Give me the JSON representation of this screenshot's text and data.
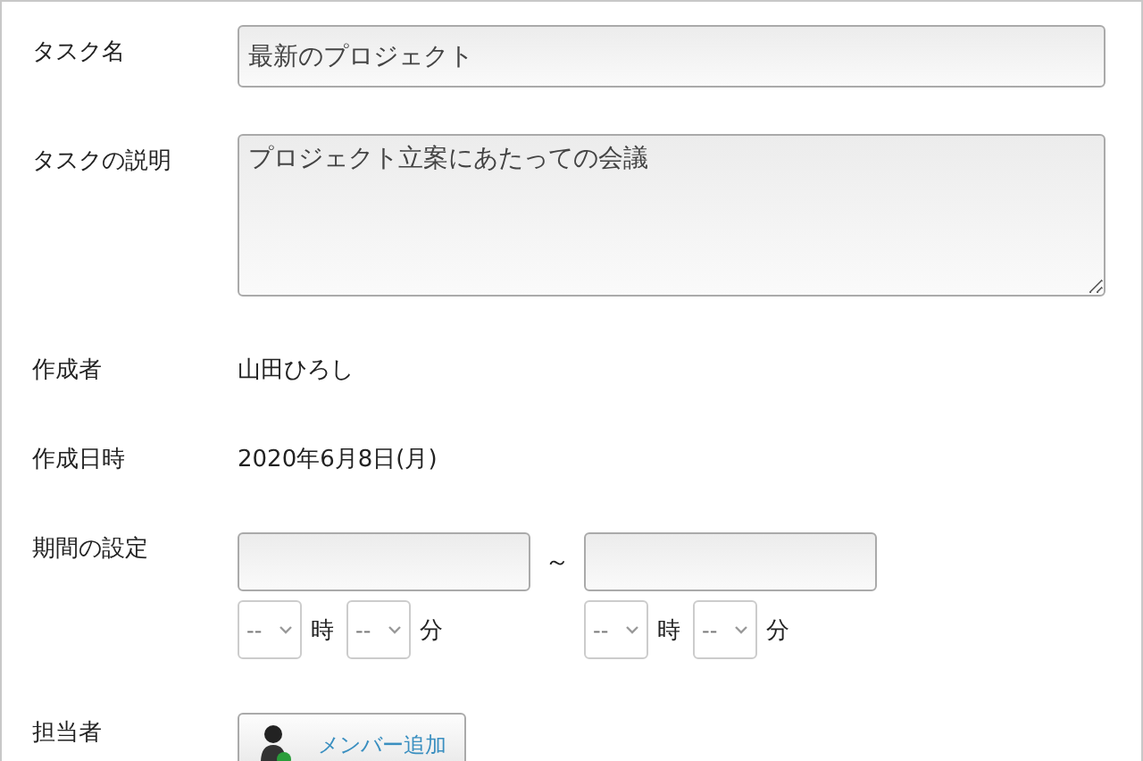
{
  "rows": [
    {
      "kind": "input",
      "label": "タスク名",
      "value": "最新のプロジェクト"
    },
    {
      "kind": "textarea",
      "label": "タスクの説明",
      "value": "プロジェクト立案にあたっての会議"
    },
    {
      "kind": "text",
      "label": "作成者",
      "value": "山田ひろし"
    },
    {
      "kind": "text",
      "label": "作成日時",
      "value": "2020年6月8日(月)"
    },
    {
      "kind": "period",
      "label": "期間の設定",
      "separator": "～",
      "ends": [
        {
          "hour": "--",
          "hour_unit": "時",
          "minute": "--",
          "minute_unit": "分"
        },
        {
          "hour": "--",
          "hour_unit": "時",
          "minute": "--",
          "minute_unit": "分"
        }
      ]
    },
    {
      "kind": "member",
      "label": "担当者",
      "button": "メンバー追加"
    }
  ]
}
